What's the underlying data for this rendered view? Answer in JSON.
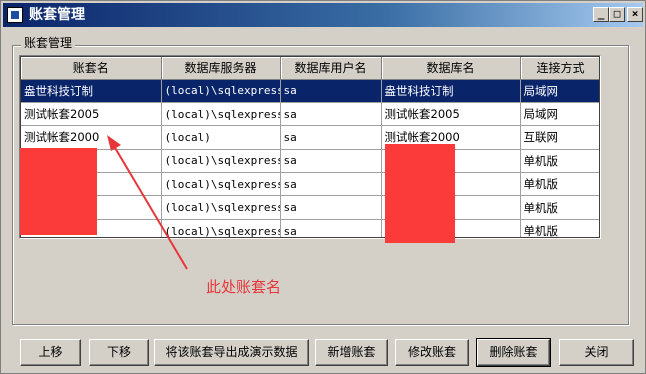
{
  "window": {
    "title": "账套管理"
  },
  "titlebar_buttons": {
    "minimize": "_",
    "maximize": "□",
    "close": "×"
  },
  "group": {
    "label": "账套管理"
  },
  "table": {
    "columns": [
      "账套名",
      "数据库服务器",
      "数据库用户名",
      "数据库名",
      "连接方式"
    ],
    "rows": [
      [
        "盎世科技订制",
        "(local)\\sqlexpress",
        "sa",
        "盎世科技订制",
        "局域网"
      ],
      [
        "测试帐套2005",
        "(local)\\sqlexpress",
        "sa",
        "测试帐套2005",
        "局域网"
      ],
      [
        "测试帐套2000",
        "(local)",
        "sa",
        "测试帐套2000",
        "互联网"
      ],
      [
        "",
        "(local)\\sqlexpress",
        "sa",
        "",
        "单机版"
      ],
      [
        "",
        "(local)\\sqlexpress",
        "sa",
        "",
        "单机版"
      ],
      [
        "",
        "(local)\\sqlexpress",
        "sa",
        "",
        "单机版"
      ],
      [
        "",
        "(local)\\sqlexpress",
        "sa",
        "",
        "单机版"
      ]
    ],
    "selected_row": 0
  },
  "annotation": {
    "text": "此处账套名",
    "color": "#e8373a"
  },
  "buttons": {
    "up": "上移",
    "down": "下移",
    "export_demo": "将该账套导出成演示数据",
    "add": "新增账套",
    "edit": "修改账套",
    "delete": "删除账套",
    "close": "关闭"
  },
  "colors": {
    "title_bar": "#0a246a",
    "selection": "#0a246a",
    "redaction": "#fb3a3a"
  }
}
